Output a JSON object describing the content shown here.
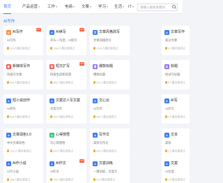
{
  "nav": {
    "items": [
      {
        "label": "首页"
      },
      {
        "label": "产品运营"
      },
      {
        "label": "工作"
      },
      {
        "label": "电商"
      },
      {
        "label": "文案"
      },
      {
        "label": "学习"
      },
      {
        "label": "生活"
      },
      {
        "label": "IT"
      }
    ],
    "search_placeholder": "请输入搜索关键词"
  },
  "section": {
    "title": "AI写作"
  },
  "cards": [
    {
      "icon": "AI",
      "title": "AI写作",
      "desc": "AI写作",
      "stats": "293人最近使用过",
      "badge": "HOT"
    },
    {
      "icon": "A",
      "title": "AI续写",
      "desc": "开头一句话，AI续写",
      "stats": "1464人最近使用过",
      "badge": "HOT"
    },
    {
      "icon": "文",
      "title": "文章风格改写",
      "desc": "文章风格改写",
      "stats": "1034人最近使用过",
      "badge": ""
    },
    {
      "icon": "A",
      "title": "文章写作",
      "desc": "高分文章",
      "stats": "9人最近使用过",
      "badge": ""
    },
    {
      "icon": "新",
      "title": "新媒体写作",
      "desc": "快速写文章",
      "stats": "986人最近使用过",
      "badge": ""
    },
    {
      "icon": "短",
      "title": "短文扩写",
      "desc": "快速生成新段落",
      "stats": "858人最近使用过",
      "badge": "HOT"
    },
    {
      "icon": "爆",
      "title": "爆款标题",
      "desc": "爆款标题",
      "stats": "541人最近使用过",
      "badge": ""
    },
    {
      "icon": "标",
      "title": "标题",
      "desc": "给试写标题",
      "stats": "5人最近使用过",
      "badge": ""
    },
    {
      "icon": "A",
      "title": "短小说创作",
      "desc": "AI创作",
      "stats": "558人最近使用过",
      "badge": ""
    },
    {
      "icon": "A",
      "title": "文案达人写文案",
      "desc": "文案写作",
      "stats": "265人最近使用过",
      "badge": ""
    },
    {
      "icon": "A",
      "title": "文心云",
      "desc": "AI写作",
      "stats": "460人最近使用过",
      "badge": ""
    },
    {
      "icon": "A",
      "title": "AI写",
      "desc": "AI文写",
      "stats": "3人最近使用过",
      "badge": ""
    },
    {
      "icon": "A",
      "title": "文章润色1.0",
      "desc": "中文文章润色",
      "stats": "1131人最近使用过",
      "badge": ""
    },
    {
      "icon": "心",
      "title": "心得感悟",
      "desc": "写心得感悟",
      "stats": "643人最近使用过",
      "badge": ""
    },
    {
      "icon": "A",
      "title": "写作文",
      "desc": "高效写作文",
      "stats": "400人最近使用过",
      "badge": ""
    },
    {
      "icon": "A",
      "title": "文本",
      "desc": "高效",
      "stats": "2人最近使用过",
      "badge": ""
    },
    {
      "icon": "A",
      "title": "AI作小说",
      "desc": "AI写小说",
      "stats": "168人最近使用过",
      "badge": ""
    },
    {
      "icon": "A",
      "title": "AI作文",
      "desc": "AI作文",
      "stats": "746人最近使用过",
      "badge": "HOT"
    },
    {
      "icon": "A",
      "title": "文案训练",
      "desc": "一键训练，文案写",
      "stats": "93人最近使用过",
      "badge": ""
    },
    {
      "icon": "A",
      "title": "文案",
      "desc": "AI文案",
      "stats": "1人最近使用过",
      "badge": ""
    }
  ]
}
